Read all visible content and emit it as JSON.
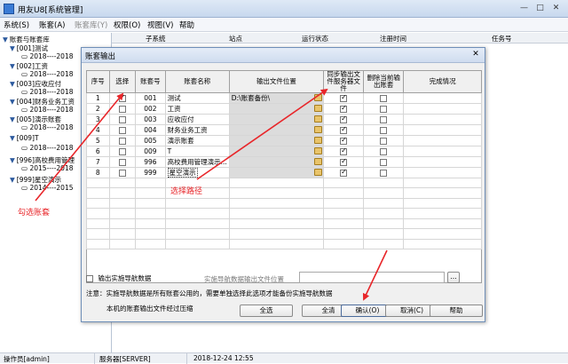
{
  "app": {
    "title": "用友U8[系统管理]"
  },
  "menu": [
    "系统(S)",
    "账套(A)",
    "账套库(Y)",
    "权限(O)",
    "视图(V)",
    "帮助"
  ],
  "menu_disabled": [
    false,
    false,
    true,
    false,
    false,
    false
  ],
  "tree": {
    "root": "账套与账套库",
    "items": [
      {
        "label": "[001]测试",
        "sub": "2018----2018"
      },
      {
        "label": "[002]工资",
        "sub": "2018----2018"
      },
      {
        "label": "[003]应收应付",
        "sub": "2018----2018"
      },
      {
        "label": "[004]财务业务工资",
        "sub": "2018----2018"
      },
      {
        "label": "[005]演示账套",
        "sub": "2018----2018"
      },
      {
        "label": "[009]T",
        "sub": "2018----2018"
      },
      {
        "label": "[996]高校费用管理",
        "sub": "2015----2018"
      },
      {
        "label": "[999]星空演示",
        "sub": "2014----2015"
      }
    ]
  },
  "main_columns": [
    "子系统",
    "站点",
    "运行状态",
    "注册时间",
    "任务号"
  ],
  "dialog": {
    "title": "账套输出",
    "columns": [
      "序号",
      "选择",
      "账套号",
      "账套名称",
      "输出文件位置",
      "同步输出文件服务器文件",
      "删除当前输出账套",
      "完成情况"
    ],
    "rows": [
      {
        "no": "1",
        "selected": true,
        "code": "001",
        "name": "测试",
        "path": "D:\\账套备份\\",
        "sync": true,
        "del": false
      },
      {
        "no": "2",
        "selected": false,
        "code": "002",
        "name": "工资",
        "path": "",
        "sync": true,
        "del": false
      },
      {
        "no": "3",
        "selected": false,
        "code": "003",
        "name": "应收应付",
        "path": "",
        "sync": true,
        "del": false
      },
      {
        "no": "4",
        "selected": false,
        "code": "004",
        "name": "财务业务工资",
        "path": "",
        "sync": true,
        "del": false
      },
      {
        "no": "5",
        "selected": false,
        "code": "005",
        "name": "演示账套",
        "path": "",
        "sync": true,
        "del": false
      },
      {
        "no": "6",
        "selected": false,
        "code": "009",
        "name": "T",
        "path": "",
        "sync": true,
        "del": false
      },
      {
        "no": "7",
        "selected": false,
        "code": "996",
        "name": "高校费用管理演示...",
        "path": "",
        "sync": true,
        "del": false
      },
      {
        "no": "8",
        "selected": false,
        "code": "999",
        "name": "星空演示",
        "path": "",
        "sync": true,
        "del": false
      }
    ],
    "nav_checkbox_label": "输出实施导航数据",
    "nav_file_label": "实施导航数据输出文件位置",
    "note": "注意：实施导航数据是所有账套公用的，需要单独选择此选项才能备份实施导航数据",
    "zip_note": "本机的账套输出文件经过压缩",
    "buttons": {
      "select_all": "全选",
      "clear_all": "全清",
      "ok": "确认(O)",
      "cancel": "取消(C)",
      "help": "帮助"
    }
  },
  "annotations": {
    "select_path": "选择路径",
    "check_account": "勾选账套",
    "color": "#e8262a"
  },
  "status": {
    "operator": "操作员[admin]",
    "server": "服务器[SERVER]",
    "time": "2018-12-24 12:55"
  }
}
